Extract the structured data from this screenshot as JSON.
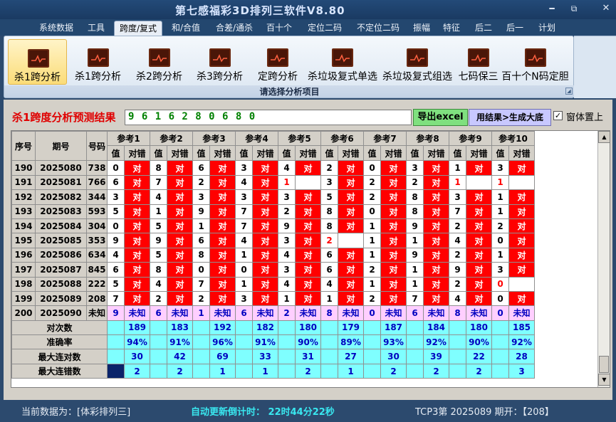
{
  "app_title": "第七感福彩3D排列三软件V8.80",
  "window_controls": {
    "minimize": "━",
    "maximize": "⧉",
    "close": "✕"
  },
  "menu": [
    "系统数据",
    "工具",
    "跨度/复式",
    "和/合值",
    "合差/通杀",
    "百十个",
    "定位二码",
    "不定位二码",
    "振幅",
    "特征",
    "后二",
    "后一",
    "计划"
  ],
  "menu_active": "跨度/复式",
  "ribbon": {
    "buttons": [
      "杀1跨分析",
      "杀1跨分析",
      "杀2跨分析",
      "杀3跨分析",
      "定跨分析",
      "杀垃圾复式单选",
      "杀垃圾复式组选",
      "七码保三",
      "百十个N码定胆"
    ],
    "active_index": 0,
    "caption": "请选择分析项目"
  },
  "panel": {
    "title": "杀1跨度分析预测结果",
    "result_value": "9 6 1 6 2 8 0 6 8 0",
    "export_button": "导出excel",
    "apply_button": "用结果>生成大底",
    "on_top_label": "窗体置上",
    "on_top_checked": "✓"
  },
  "table": {
    "col_seq": "序号",
    "col_period": "期号",
    "col_code": "号码",
    "ref_headers": [
      "参考1",
      "参考2",
      "参考3",
      "参考4",
      "参考5",
      "参考6",
      "参考7",
      "参考8",
      "参考9",
      "参考10"
    ],
    "sub_value": "值",
    "sub_check": "对错",
    "rows": [
      {
        "seq": "190",
        "period": "2025080",
        "code": "738",
        "cells": [
          [
            "0",
            "对"
          ],
          [
            "8",
            "对"
          ],
          [
            "6",
            "对"
          ],
          [
            "3",
            "对"
          ],
          [
            "4",
            "对"
          ],
          [
            "2",
            "对"
          ],
          [
            "0",
            "对"
          ],
          [
            "3",
            "对"
          ],
          [
            "1",
            "对"
          ],
          [
            "3",
            "对"
          ]
        ]
      },
      {
        "seq": "191",
        "period": "2025081",
        "code": "766",
        "cells": [
          [
            "6",
            "对"
          ],
          [
            "7",
            "对"
          ],
          [
            "2",
            "对"
          ],
          [
            "4",
            "对"
          ],
          [
            "1",
            ""
          ],
          [
            "3",
            "对"
          ],
          [
            "2",
            "对"
          ],
          [
            "2",
            "对"
          ],
          [
            "1",
            ""
          ],
          [
            "1",
            ""
          ]
        ]
      },
      {
        "seq": "192",
        "period": "2025082",
        "code": "344",
        "cells": [
          [
            "3",
            "对"
          ],
          [
            "4",
            "对"
          ],
          [
            "3",
            "对"
          ],
          [
            "3",
            "对"
          ],
          [
            "3",
            "对"
          ],
          [
            "5",
            "对"
          ],
          [
            "2",
            "对"
          ],
          [
            "8",
            "对"
          ],
          [
            "3",
            "对"
          ],
          [
            "1",
            "对"
          ]
        ]
      },
      {
        "seq": "193",
        "period": "2025083",
        "code": "593",
        "cells": [
          [
            "5",
            "对"
          ],
          [
            "1",
            "对"
          ],
          [
            "9",
            "对"
          ],
          [
            "7",
            "对"
          ],
          [
            "2",
            "对"
          ],
          [
            "8",
            "对"
          ],
          [
            "0",
            "对"
          ],
          [
            "8",
            "对"
          ],
          [
            "7",
            "对"
          ],
          [
            "1",
            "对"
          ]
        ]
      },
      {
        "seq": "194",
        "period": "2025084",
        "code": "304",
        "cells": [
          [
            "0",
            "对"
          ],
          [
            "5",
            "对"
          ],
          [
            "1",
            "对"
          ],
          [
            "7",
            "对"
          ],
          [
            "9",
            "对"
          ],
          [
            "8",
            "对"
          ],
          [
            "1",
            "对"
          ],
          [
            "9",
            "对"
          ],
          [
            "2",
            "对"
          ],
          [
            "2",
            "对"
          ]
        ]
      },
      {
        "seq": "195",
        "period": "2025085",
        "code": "353",
        "cells": [
          [
            "9",
            "对"
          ],
          [
            "9",
            "对"
          ],
          [
            "6",
            "对"
          ],
          [
            "4",
            "对"
          ],
          [
            "3",
            "对"
          ],
          [
            "2",
            ""
          ],
          [
            "1",
            "对"
          ],
          [
            "1",
            "对"
          ],
          [
            "4",
            "对"
          ],
          [
            "0",
            "对"
          ]
        ]
      },
      {
        "seq": "196",
        "period": "2025086",
        "code": "634",
        "cells": [
          [
            "4",
            "对"
          ],
          [
            "5",
            "对"
          ],
          [
            "8",
            "对"
          ],
          [
            "1",
            "对"
          ],
          [
            "4",
            "对"
          ],
          [
            "6",
            "对"
          ],
          [
            "1",
            "对"
          ],
          [
            "9",
            "对"
          ],
          [
            "2",
            "对"
          ],
          [
            "1",
            "对"
          ]
        ]
      },
      {
        "seq": "197",
        "period": "2025087",
        "code": "845",
        "cells": [
          [
            "6",
            "对"
          ],
          [
            "8",
            "对"
          ],
          [
            "0",
            "对"
          ],
          [
            "0",
            "对"
          ],
          [
            "3",
            "对"
          ],
          [
            "6",
            "对"
          ],
          [
            "2",
            "对"
          ],
          [
            "1",
            "对"
          ],
          [
            "9",
            "对"
          ],
          [
            "3",
            "对"
          ]
        ]
      },
      {
        "seq": "198",
        "period": "2025088",
        "code": "222",
        "cells": [
          [
            "5",
            "对"
          ],
          [
            "4",
            "对"
          ],
          [
            "7",
            "对"
          ],
          [
            "1",
            "对"
          ],
          [
            "4",
            "对"
          ],
          [
            "4",
            "对"
          ],
          [
            "1",
            "对"
          ],
          [
            "1",
            "对"
          ],
          [
            "2",
            "对"
          ],
          [
            "0",
            ""
          ]
        ]
      },
      {
        "seq": "199",
        "period": "2025089",
        "code": "208",
        "cells": [
          [
            "7",
            "对"
          ],
          [
            "2",
            "对"
          ],
          [
            "2",
            "对"
          ],
          [
            "3",
            "对"
          ],
          [
            "1",
            "对"
          ],
          [
            "1",
            "对"
          ],
          [
            "2",
            "对"
          ],
          [
            "7",
            "对"
          ],
          [
            "4",
            "对"
          ],
          [
            "0",
            "对"
          ]
        ]
      }
    ],
    "pred_row": {
      "seq": "200",
      "period": "2025090",
      "code": "未知",
      "values": [
        "9",
        "6",
        "1",
        "6",
        "2",
        "8",
        "0",
        "6",
        "8",
        "0"
      ],
      "unknown": "未知"
    },
    "stats": [
      {
        "label": "对次数",
        "values": [
          "189",
          "183",
          "192",
          "182",
          "180",
          "179",
          "187",
          "184",
          "180",
          "185"
        ]
      },
      {
        "label": "准确率",
        "values": [
          "94%",
          "91%",
          "96%",
          "91%",
          "90%",
          "89%",
          "93%",
          "92%",
          "90%",
          "92%"
        ]
      },
      {
        "label": "最大连对数",
        "values": [
          "30",
          "42",
          "69",
          "33",
          "31",
          "27",
          "30",
          "39",
          "22",
          "28"
        ]
      },
      {
        "label": "最大连错数",
        "values": [
          "2",
          "2",
          "1",
          "1",
          "2",
          "1",
          "2",
          "2",
          "2",
          "3"
        ]
      }
    ]
  },
  "status": {
    "source": "当前数据为：[体彩排列三]",
    "timer": "自动更新倒计时：  22时44分22秒",
    "period": "TCP3第 2025089 期开：【208】"
  }
}
